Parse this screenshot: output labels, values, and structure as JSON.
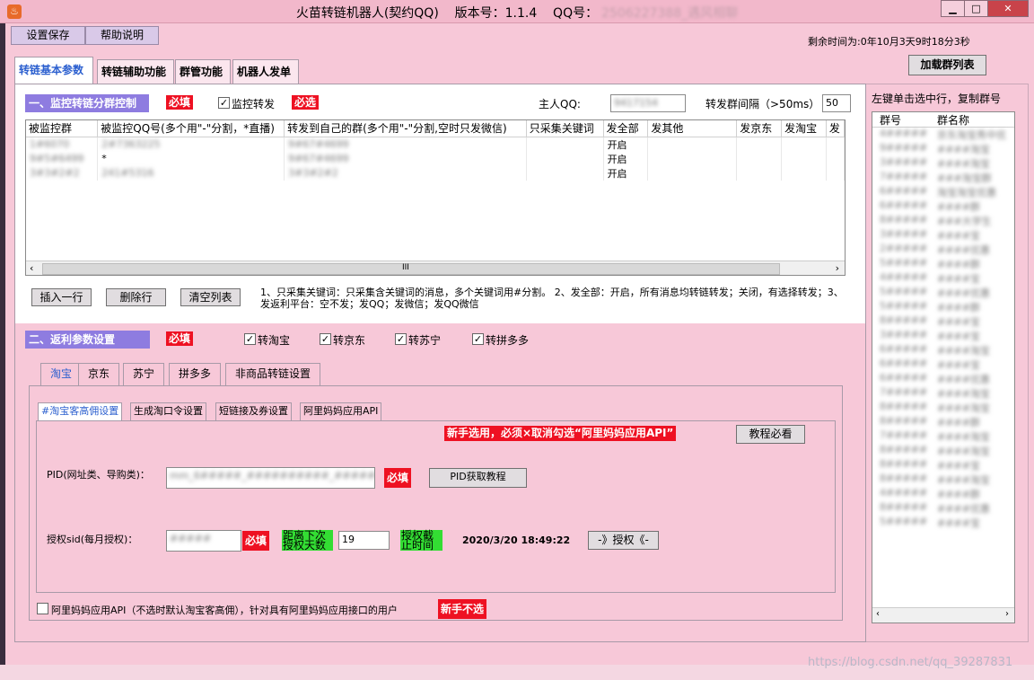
{
  "window": {
    "title": "火苗转链机器人(契约QQ)",
    "version_label": "版本号：1.1.4",
    "qq_label": "QQ号：",
    "qq_value": "2506227388_遇风相聊",
    "app_icon": "flame-icon",
    "minimize": "▁",
    "maximize": "□",
    "close": "✕"
  },
  "menu": {
    "save_settings": "设置保存",
    "help": "帮助说明"
  },
  "remaining_time": "剩余时间为:0年10月3天9时18分3秒",
  "load_groups_button": "加载群列表",
  "right_hint": "左键单击选中行，复制群号",
  "tabs": [
    "转链基本参数",
    "转链辅助功能",
    "群管功能",
    "机器人发单"
  ],
  "section1": {
    "title": "一、监控转链分群控制",
    "required": "必填",
    "monitor_forward_label": "监控转发",
    "monitor_forward_checked": true,
    "must_select": "必选",
    "owner_qq_label": "主人QQ:",
    "owner_qq_value": "9417154",
    "interval_label": "转发群间隔（>50ms）",
    "interval_value": "50"
  },
  "grid": {
    "columns": [
      "被监控群",
      "被监控QQ号(多个用\"-\"分割，*直播)",
      "转发到自己的群(多个用\"-\"分割,空时只发微信)",
      "只采集关键词",
      "发全部",
      "发其他",
      "发京东",
      "发淘宝",
      "发"
    ],
    "rows": [
      [
        "1#6070",
        "2#7363225",
        "9#67#4699",
        "",
        "开启",
        "",
        "",
        "",
        ""
      ],
      [
        "9#5#6499",
        "*",
        "9#67#4699",
        "",
        "开启",
        "",
        "",
        "",
        ""
      ],
      [
        "3#3#2#2",
        "241#5316",
        "3#3#2#2",
        "",
        "开启",
        "",
        "",
        "",
        ""
      ]
    ],
    "scroll_marker": "III"
  },
  "grid_buttons": {
    "insert": "插入一行",
    "delete": "删除行",
    "clear": "清空列表"
  },
  "grid_notes": "1、只采集关键词：只采集含关键词的消息，多个关键词用#分割。  2、发全部：开启，所有消息均转链转发；关闭，有选择转发；3、发返利平台：空不发；发QQ；发微信；发QQ微信",
  "section2": {
    "title": "二、返利参数设置",
    "required": "必填",
    "checks": [
      {
        "label": "转淘宝",
        "checked": true
      },
      {
        "label": "转京东",
        "checked": true
      },
      {
        "label": "转苏宁",
        "checked": true
      },
      {
        "label": "转拼多多",
        "checked": true
      }
    ]
  },
  "platform_tabs": [
    "淘宝",
    "京东",
    "苏宁",
    "拼多多",
    "非商品转链设置"
  ],
  "taobao_tabs": [
    "#淘宝客高佣设置",
    "生成淘口令设置",
    "短链接及券设置",
    "阿里妈妈应用API"
  ],
  "taobao": {
    "newbie_warning": "新手选用，必须×取消勾选“阿里妈妈应用API”",
    "tutorial_button": "教程必看",
    "pid_label": "PID(网址类、导购类)：",
    "pid_value": "mm_6#####_##########_##########",
    "pid_required": "必填",
    "pid_tutorial_button": "PID获取教程",
    "sid_label": "授权sid(每月授权)：",
    "sid_value": "#####",
    "sid_required": "必填",
    "days_label": "距离下次授权天数",
    "days_value": "19",
    "deadline_label": "授权截止时间",
    "deadline_value": "2020/3/20 18:49:22",
    "auth_button": "-》授权《-",
    "api_checkbox_label": "阿里妈妈应用API（不选时默认淘宝客高佣），针对具有阿里妈妈应用接口的用户",
    "api_checked": false,
    "newbie_no_select": "新手不选"
  },
  "group_list": {
    "col_id": "群号",
    "col_name": "群名称",
    "rows": [
      [
        "4#####",
        "京东淘宝秀中优"
      ],
      [
        "9#####",
        "####淘宝"
      ],
      [
        "3#####",
        "####淘宝"
      ],
      [
        "7#####",
        "###淘宝群"
      ],
      [
        "6#####",
        "淘宝淘宝优惠"
      ],
      [
        "6#####",
        "####群"
      ],
      [
        "8#####",
        "###大学生"
      ],
      [
        "3#####",
        "####宝"
      ],
      [
        "2#####",
        "####优惠"
      ],
      [
        "5#####",
        "####群"
      ],
      [
        "4#####",
        "####宝"
      ],
      [
        "5#####",
        "####优惠"
      ],
      [
        "5#####",
        "####群"
      ],
      [
        "8#####",
        "####宝"
      ],
      [
        "3#####",
        "####宝"
      ],
      [
        "6#####",
        "####淘宝"
      ],
      [
        "6#####",
        "####宝"
      ],
      [
        "6#####",
        "####优惠"
      ],
      [
        "7#####",
        "####淘宝"
      ],
      [
        "8#####",
        "####淘宝"
      ],
      [
        "8#####",
        "####群"
      ],
      [
        "7#####",
        "####淘宝"
      ],
      [
        "8#####",
        "####淘宝"
      ],
      [
        "8#####",
        "####宝"
      ],
      [
        "8#####",
        "####淘宝"
      ],
      [
        "4#####",
        "####群"
      ],
      [
        "8#####",
        "####优惠"
      ],
      [
        "5#####",
        "####宝"
      ]
    ]
  },
  "watermark": "https://blog.csdn.net/qq_39287831",
  "colors": {
    "section_header": "#8e7ce0",
    "required_red": "#ee1122",
    "green_label": "#33dd33",
    "bg_pink": "#f7c8d8",
    "tab_blue": "#2b5fcf"
  }
}
